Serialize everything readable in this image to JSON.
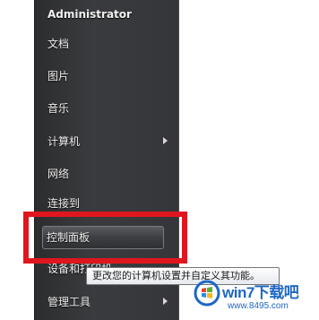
{
  "start_menu": {
    "user_name": "Administrator",
    "items": [
      {
        "label": "文档"
      },
      {
        "label": "图片"
      },
      {
        "label": "音乐"
      },
      {
        "label": "计算机",
        "has_submenu": true
      },
      {
        "label": "网络"
      },
      {
        "label": "连接到"
      },
      {
        "label": "控制面板",
        "selected": true
      },
      {
        "label": "设备和打印机"
      },
      {
        "label": "管理工具",
        "has_submenu": true
      }
    ]
  },
  "tooltip": {
    "text": "更改您的计算机设置并自定义其功能。"
  },
  "watermark": {
    "title": "win7下载吧",
    "url": "www.8495.com"
  },
  "colors": {
    "highlight_border": "#e0161e",
    "watermark_blue": "#1d67c4"
  }
}
